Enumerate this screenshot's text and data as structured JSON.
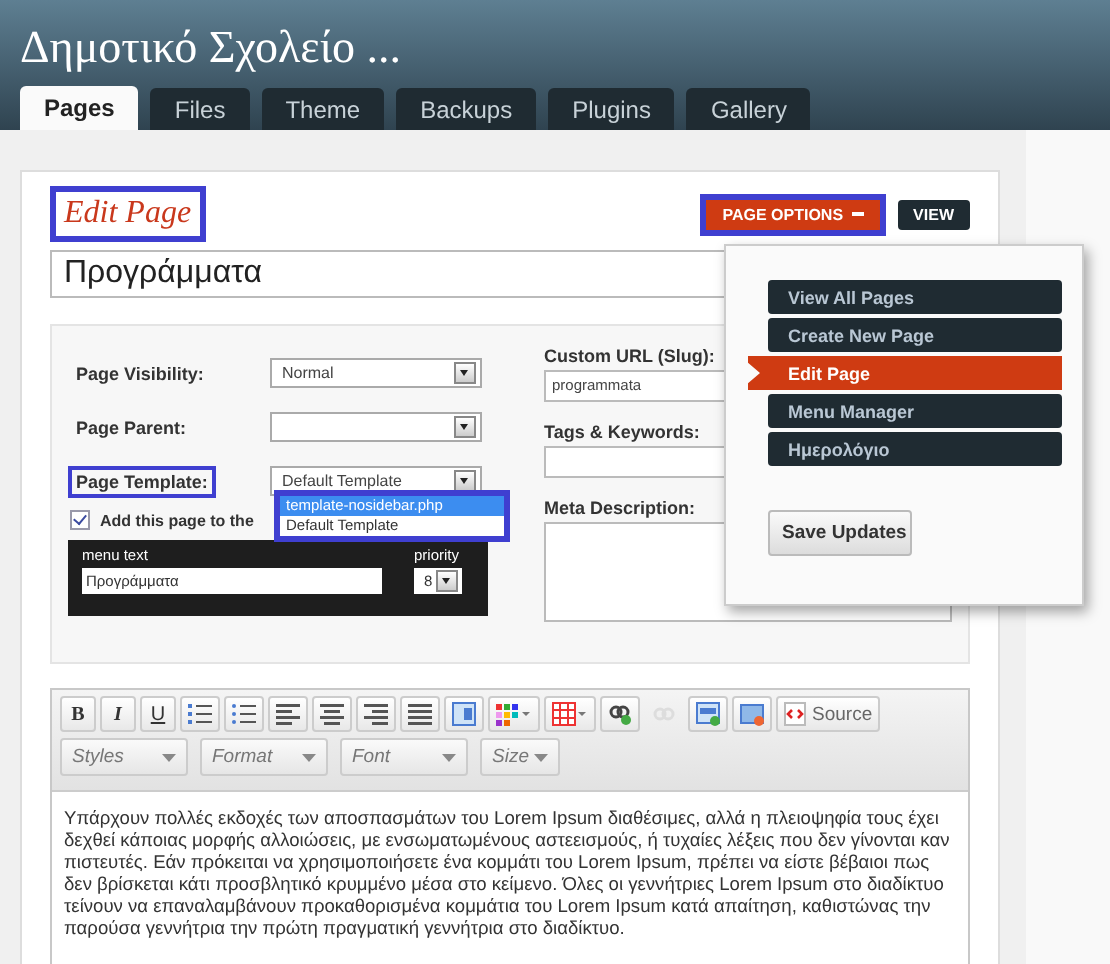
{
  "site_title": "Δημοτικό Σχολείο ...",
  "tabs": [
    {
      "label": "Pages",
      "selected": true
    },
    {
      "label": "Files",
      "selected": false
    },
    {
      "label": "Theme",
      "selected": false
    },
    {
      "label": "Backups",
      "selected": false
    },
    {
      "label": "Plugins",
      "selected": false
    },
    {
      "label": "Gallery",
      "selected": false
    }
  ],
  "heading": {
    "text": "Edit Page",
    "highlighted": true
  },
  "page_options_button": {
    "label": "PAGE OPTIONS",
    "highlighted": true
  },
  "view_button": "VIEW",
  "title_field": {
    "value": "Προγράμματα"
  },
  "left_fields": [
    {
      "label": "Page Visibility:",
      "value": "Normal",
      "highlighted": false
    },
    {
      "label": "Page Parent:",
      "highlighted": false
    },
    {
      "label": "Page Template:",
      "value": "Default Template",
      "highlighted": true
    }
  ],
  "template_dropdown": {
    "highlighted": true,
    "options": [
      {
        "label": "template-nosidebar.php",
        "selected": true
      },
      {
        "label": "Default Template",
        "selected": false
      }
    ]
  },
  "menu_checkbox": {
    "label": "Add this page to the",
    "checked": true
  },
  "menu_box": {
    "menu_text_label": "menu text",
    "menu_text": "Προγράμματα",
    "priority_label": "priority",
    "priority": "8"
  },
  "right_fields": [
    {
      "label": "Custom URL (Slug):",
      "kind": "input",
      "value": "programmata"
    },
    {
      "label": "Tags & Keywords:",
      "kind": "input"
    },
    {
      "label": "Meta Description:",
      "kind": "textarea"
    }
  ],
  "options_menu": {
    "items": [
      {
        "label": "View All Pages",
        "selected": false
      },
      {
        "label": "Create New Page",
        "selected": false
      },
      {
        "label": "Edit Page",
        "selected": true
      },
      {
        "label": "Menu Manager",
        "selected": false
      },
      {
        "label": "Ημερολόγιο",
        "selected": false
      }
    ],
    "save_button": "Save Updates"
  },
  "editor": {
    "format_buttons": [
      "B",
      "I",
      "U"
    ],
    "source_button": "Source",
    "dropdowns": [
      "Styles",
      "Format",
      "Font",
      "Size"
    ],
    "content": "Υπάρχουν πολλές εκδοχές των αποσπασμάτων του Lorem Ipsum διαθέσιμες, αλλά η πλειοψηφία τους έχει δεχθεί κάποιας μορφής αλλοιώσεις, με ενσωματωμένους αστεεισμούς, ή τυχαίες λέξεις που δεν γίνονται καν πιστευτές. Εάν πρόκειται να χρησιμοποιήσετε ένα κομμάτι του Lorem Ipsum, πρέπει να είστε βέβαιοι πως δεν βρίσκεται κάτι προσβλητικό κρυμμένο μέσα στο κείμενο. Όλες οι γεννήτριες Lorem Ipsum στο διαδίκτυο τείνουν να επαναλαμβάνουν προκαθορισμένα κομμάτια του Lorem Ipsum κατά απαίτηση, καθιστώνας την παρούσα γεννήτρια την πρώτη πραγματική γεννήτρια στο διαδίκτυο."
  }
}
